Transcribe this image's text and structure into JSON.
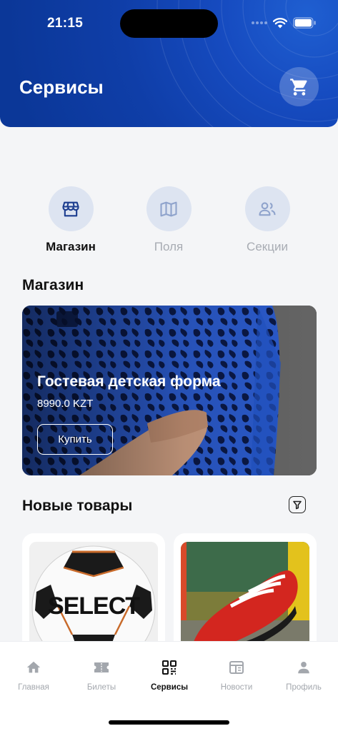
{
  "status_bar": {
    "time": "21:15"
  },
  "header": {
    "title": "Сервисы",
    "cart_icon": "cart-icon"
  },
  "categories": [
    {
      "label": "Магазин",
      "icon": "storefront-icon",
      "active": true
    },
    {
      "label": "Поля",
      "icon": "map-icon",
      "active": false
    },
    {
      "label": "Секции",
      "icon": "people-icon",
      "active": false
    }
  ],
  "shop": {
    "title": "Магазин",
    "banner": {
      "title": "Гостевая детская форма",
      "price": "8990.0 KZT",
      "button": "Купить"
    }
  },
  "new_products": {
    "title": "Новые товары",
    "filter_icon": "filter-icon",
    "items": [
      {
        "image": "soccer-ball-image",
        "brand_text": "SELECT"
      },
      {
        "image": "red-football-boot-image"
      }
    ]
  },
  "tabbar": {
    "items": [
      {
        "label": "Главная",
        "icon": "home-icon",
        "active": false
      },
      {
        "label": "Билеты",
        "icon": "ticket-icon",
        "active": false
      },
      {
        "label": "Сервисы",
        "icon": "grid-icon",
        "active": true
      },
      {
        "label": "Новости",
        "icon": "news-icon",
        "active": false
      },
      {
        "label": "Профиль",
        "icon": "profile-icon",
        "active": false
      }
    ]
  },
  "colors": {
    "header_blue": "#0f3ea8",
    "accent_blue": "#1c3d8f",
    "inactive_icon": "#8fa3cc",
    "inactive_text": "#a8acb3"
  }
}
